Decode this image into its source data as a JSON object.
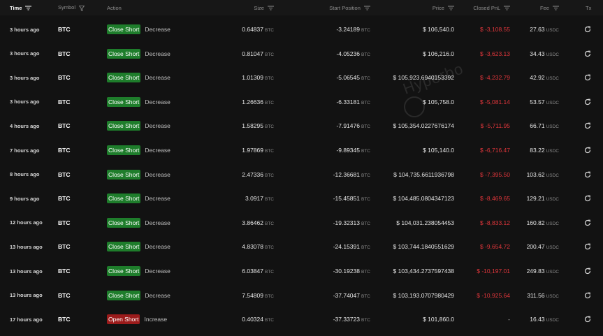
{
  "header": {
    "time": "Time",
    "symbol": "Symbol",
    "action": "Action",
    "size": "Size",
    "start_position": "Start Position",
    "price": "Price",
    "closed_pnl": "Closed PnL",
    "fee": "Fee",
    "tx": "Tx"
  },
  "watermark": "Hyperbo",
  "units": {
    "btc": "BTC",
    "usdc": "USDC"
  },
  "rows": [
    {
      "time": "3 hours ago",
      "symbol": "BTC",
      "badge": "Close Short",
      "sub": "Decrease",
      "size": "0.64837",
      "start": "-3.24189",
      "price": "$ 106,540.0",
      "pnl": "$ -3,108.55",
      "fee": "27.63"
    },
    {
      "time": "3 hours ago",
      "symbol": "BTC",
      "badge": "Close Short",
      "sub": "Decrease",
      "size": "0.81047",
      "start": "-4.05236",
      "price": "$ 106,216.0",
      "pnl": "$ -3,623.13",
      "fee": "34.43"
    },
    {
      "time": "3 hours ago",
      "symbol": "BTC",
      "badge": "Close Short",
      "sub": "Decrease",
      "size": "1.01309",
      "start": "-5.06545",
      "price": "$ 105,923.6940153392",
      "pnl": "$ -4,232.79",
      "fee": "42.92"
    },
    {
      "time": "3 hours ago",
      "symbol": "BTC",
      "badge": "Close Short",
      "sub": "Decrease",
      "size": "1.26636",
      "start": "-6.33181",
      "price": "$ 105,758.0",
      "pnl": "$ -5,081.14",
      "fee": "53.57"
    },
    {
      "time": "4 hours ago",
      "symbol": "BTC",
      "badge": "Close Short",
      "sub": "Decrease",
      "size": "1.58295",
      "start": "-7.91476",
      "price": "$ 105,354.0227676174",
      "pnl": "$ -5,711.95",
      "fee": "66.71"
    },
    {
      "time": "7 hours ago",
      "symbol": "BTC",
      "badge": "Close Short",
      "sub": "Decrease",
      "size": "1.97869",
      "start": "-9.89345",
      "price": "$ 105,140.0",
      "pnl": "$ -6,716.47",
      "fee": "83.22"
    },
    {
      "time": "8 hours ago",
      "symbol": "BTC",
      "badge": "Close Short",
      "sub": "Decrease",
      "size": "2.47336",
      "start": "-12.36681",
      "price": "$ 104,735.6611936798",
      "pnl": "$ -7,395.50",
      "fee": "103.62"
    },
    {
      "time": "9 hours ago",
      "symbol": "BTC",
      "badge": "Close Short",
      "sub": "Decrease",
      "size": "3.0917",
      "start": "-15.45851",
      "price": "$ 104,485.0804347123",
      "pnl": "$ -8,469.65",
      "fee": "129.21"
    },
    {
      "time": "12 hours ago",
      "symbol": "BTC",
      "badge": "Close Short",
      "sub": "Decrease",
      "size": "3.86462",
      "start": "-19.32313",
      "price": "$ 104,031.238054453",
      "pnl": "$ -8,833.12",
      "fee": "160.82"
    },
    {
      "time": "13 hours ago",
      "symbol": "BTC",
      "badge": "Close Short",
      "sub": "Decrease",
      "size": "4.83078",
      "start": "-24.15391",
      "price": "$ 103,744.1840551629",
      "pnl": "$ -9,654.72",
      "fee": "200.47"
    },
    {
      "time": "13 hours ago",
      "symbol": "BTC",
      "badge": "Close Short",
      "sub": "Decrease",
      "size": "6.03847",
      "start": "-30.19238",
      "price": "$ 103,434.2737597438",
      "pnl": "$ -10,197.01",
      "fee": "249.83"
    },
    {
      "time": "13 hours ago",
      "symbol": "BTC",
      "badge": "Close Short",
      "sub": "Decrease",
      "size": "7.54809",
      "start": "-37.74047",
      "price": "$ 103,193.0707980429",
      "pnl": "$ -10,925.64",
      "fee": "311.56"
    },
    {
      "time": "17 hours ago",
      "symbol": "BTC",
      "badge": "Open Short",
      "sub": "Increase",
      "size": "0.40324",
      "start": "-37.33723",
      "price": "$ 101,860.0",
      "pnl": "-",
      "fee": "16.43"
    }
  ]
}
